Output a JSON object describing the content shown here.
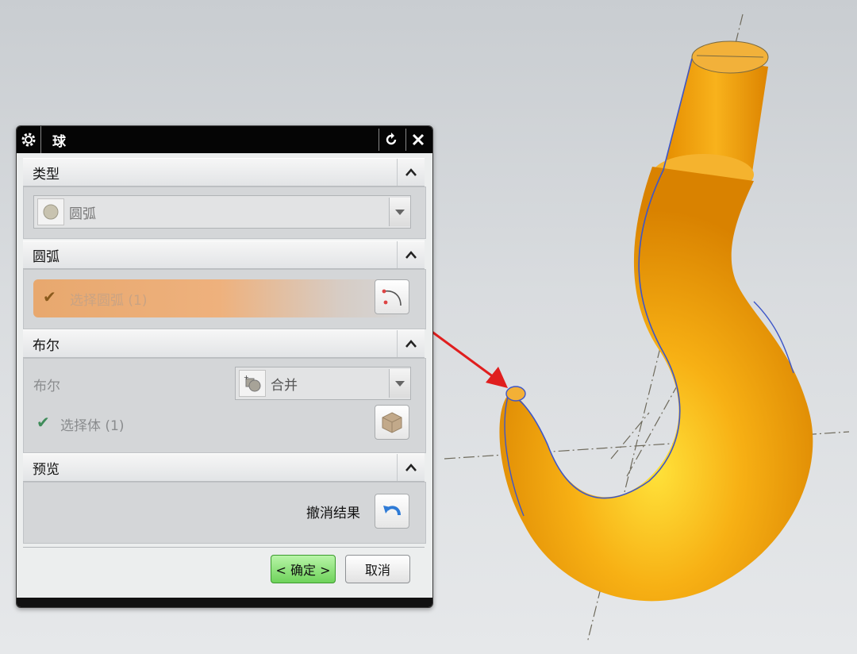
{
  "dialog": {
    "title": "球",
    "sections": {
      "type": {
        "header": "类型",
        "dropdown_value": "圆弧"
      },
      "arc": {
        "header": "圆弧",
        "select_label": "选择圆弧 (1)"
      },
      "boolean": {
        "header": "布尔",
        "field_label": "布尔",
        "dropdown_value": "合并",
        "select_body_label": "选择体 (1)"
      },
      "preview": {
        "header": "预览",
        "undo_label": "撤消结果"
      }
    },
    "footer": {
      "ok_label": "< 确定 >",
      "cancel_label": "取消"
    }
  },
  "colors": {
    "model": "#f2a413",
    "highlight": "#e8a86e",
    "ok_button": "#6fd35b",
    "arrow": "#e01e1e"
  },
  "icons": {
    "settings": "gear-icon",
    "reset": "reset-icon",
    "close": "close-icon",
    "collapse": "chevron-up-icon",
    "dropdown": "chevron-down-icon",
    "arc_type": "arc-type-icon",
    "select_arc": "select-arc-icon",
    "unite": "unite-icon",
    "select_body": "solid-body-icon",
    "undo": "undo-icon",
    "check": "check-icon"
  }
}
